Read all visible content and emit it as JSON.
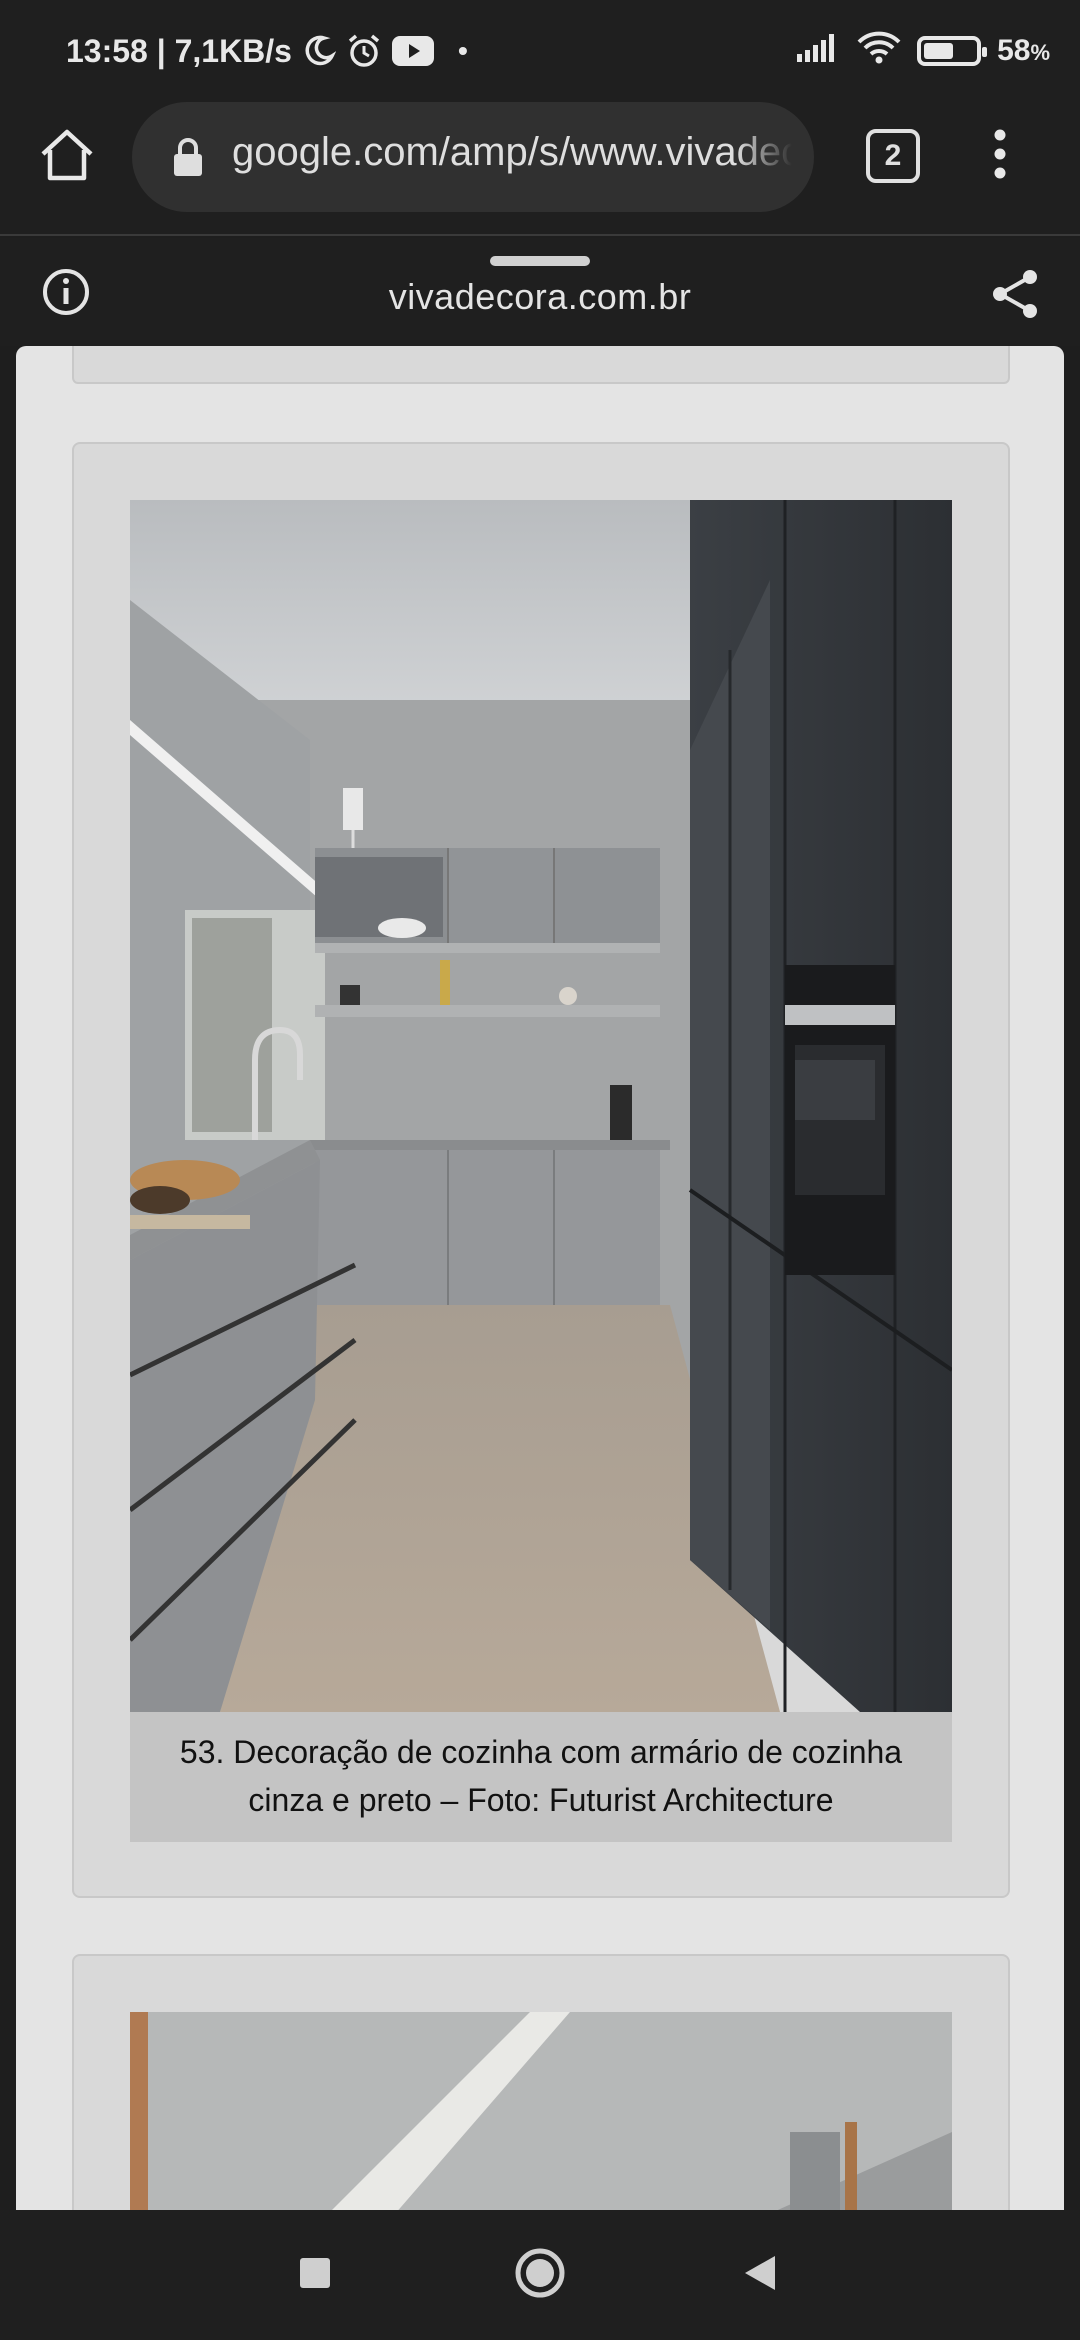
{
  "status_bar": {
    "time_speed": "13:58 | 7,1KB/s",
    "dot": "•",
    "battery_percent": "58",
    "battery_unit": "%",
    "battery_level": 0.58
  },
  "browser": {
    "url": "google.com/amp/s/www.vivadecora.com.br",
    "tab_count": "2"
  },
  "sheet": {
    "domain": "vivadecora.com.br"
  },
  "article": {
    "caption_line1": "53. Decoração de cozinha com armário de cozinha",
    "caption_line2": "cinza e preto – Foto: Futurist Architecture"
  },
  "colors": {
    "chrome_bg": "#1f1f1f",
    "url_pill": "#303030",
    "page_bg": "#e4e4e4",
    "card_bg": "#d9d9d9",
    "caption_bg": "#c4c4c4"
  }
}
